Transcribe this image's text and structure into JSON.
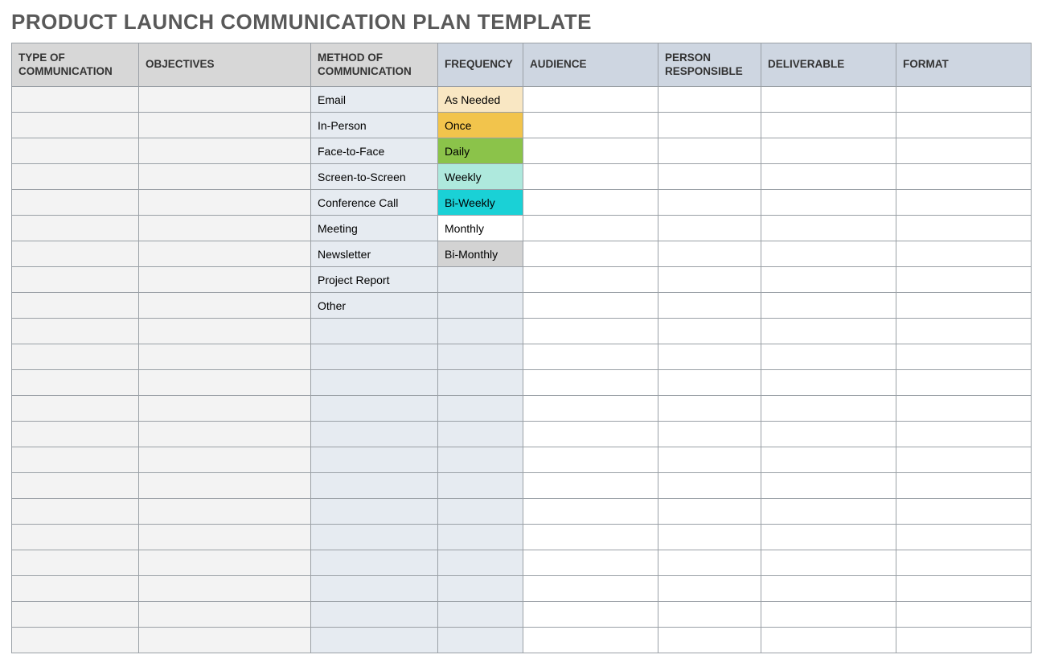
{
  "title": "PRODUCT LAUNCH COMMUNICATION PLAN TEMPLATE",
  "headers": {
    "type": "TYPE OF COMMUNICATION",
    "objectives": "OBJECTIVES",
    "method": "METHOD OF COMMUNICATION",
    "frequency": "FREQUENCY",
    "audience": "AUDIENCE",
    "person": "PERSON RESPONSIBLE",
    "deliverable": "DELIVERABLE",
    "format": "FORMAT"
  },
  "rows": [
    {
      "type": "",
      "objectives": "",
      "method": "Email",
      "frequency": "As Needed",
      "frequency_class": "freq-asneeded",
      "audience": "",
      "person": "",
      "deliverable": "",
      "format": ""
    },
    {
      "type": "",
      "objectives": "",
      "method": "In-Person",
      "frequency": "Once",
      "frequency_class": "freq-once",
      "audience": "",
      "person": "",
      "deliverable": "",
      "format": ""
    },
    {
      "type": "",
      "objectives": "",
      "method": "Face-to-Face",
      "frequency": "Daily",
      "frequency_class": "freq-daily",
      "audience": "",
      "person": "",
      "deliverable": "",
      "format": ""
    },
    {
      "type": "",
      "objectives": "",
      "method": "Screen-to-Screen",
      "frequency": "Weekly",
      "frequency_class": "freq-weekly",
      "audience": "",
      "person": "",
      "deliverable": "",
      "format": ""
    },
    {
      "type": "",
      "objectives": "",
      "method": "Conference Call",
      "frequency": "Bi-Weekly",
      "frequency_class": "freq-biweekly",
      "audience": "",
      "person": "",
      "deliverable": "",
      "format": ""
    },
    {
      "type": "",
      "objectives": "",
      "method": "Meeting",
      "frequency": "Monthly",
      "frequency_class": "freq-monthly",
      "audience": "",
      "person": "",
      "deliverable": "",
      "format": ""
    },
    {
      "type": "",
      "objectives": "",
      "method": "Newsletter",
      "frequency": "Bi-Monthly",
      "frequency_class": "freq-bimonthly",
      "audience": "",
      "person": "",
      "deliverable": "",
      "format": ""
    },
    {
      "type": "",
      "objectives": "",
      "method": "Project Report",
      "frequency": "",
      "frequency_class": "",
      "audience": "",
      "person": "",
      "deliverable": "",
      "format": ""
    },
    {
      "type": "",
      "objectives": "",
      "method": "Other",
      "frequency": "",
      "frequency_class": "",
      "audience": "",
      "person": "",
      "deliverable": "",
      "format": ""
    },
    {
      "type": "",
      "objectives": "",
      "method": "",
      "frequency": "",
      "frequency_class": "",
      "audience": "",
      "person": "",
      "deliverable": "",
      "format": ""
    },
    {
      "type": "",
      "objectives": "",
      "method": "",
      "frequency": "",
      "frequency_class": "",
      "audience": "",
      "person": "",
      "deliverable": "",
      "format": ""
    },
    {
      "type": "",
      "objectives": "",
      "method": "",
      "frequency": "",
      "frequency_class": "",
      "audience": "",
      "person": "",
      "deliverable": "",
      "format": ""
    },
    {
      "type": "",
      "objectives": "",
      "method": "",
      "frequency": "",
      "frequency_class": "",
      "audience": "",
      "person": "",
      "deliverable": "",
      "format": ""
    },
    {
      "type": "",
      "objectives": "",
      "method": "",
      "frequency": "",
      "frequency_class": "",
      "audience": "",
      "person": "",
      "deliverable": "",
      "format": ""
    },
    {
      "type": "",
      "objectives": "",
      "method": "",
      "frequency": "",
      "frequency_class": "",
      "audience": "",
      "person": "",
      "deliverable": "",
      "format": ""
    },
    {
      "type": "",
      "objectives": "",
      "method": "",
      "frequency": "",
      "frequency_class": "",
      "audience": "",
      "person": "",
      "deliverable": "",
      "format": ""
    },
    {
      "type": "",
      "objectives": "",
      "method": "",
      "frequency": "",
      "frequency_class": "",
      "audience": "",
      "person": "",
      "deliverable": "",
      "format": ""
    },
    {
      "type": "",
      "objectives": "",
      "method": "",
      "frequency": "",
      "frequency_class": "",
      "audience": "",
      "person": "",
      "deliverable": "",
      "format": ""
    },
    {
      "type": "",
      "objectives": "",
      "method": "",
      "frequency": "",
      "frequency_class": "",
      "audience": "",
      "person": "",
      "deliverable": "",
      "format": ""
    },
    {
      "type": "",
      "objectives": "",
      "method": "",
      "frequency": "",
      "frequency_class": "",
      "audience": "",
      "person": "",
      "deliverable": "",
      "format": ""
    },
    {
      "type": "",
      "objectives": "",
      "method": "",
      "frequency": "",
      "frequency_class": "",
      "audience": "",
      "person": "",
      "deliverable": "",
      "format": ""
    },
    {
      "type": "",
      "objectives": "",
      "method": "",
      "frequency": "",
      "frequency_class": "",
      "audience": "",
      "person": "",
      "deliverable": "",
      "format": ""
    }
  ]
}
